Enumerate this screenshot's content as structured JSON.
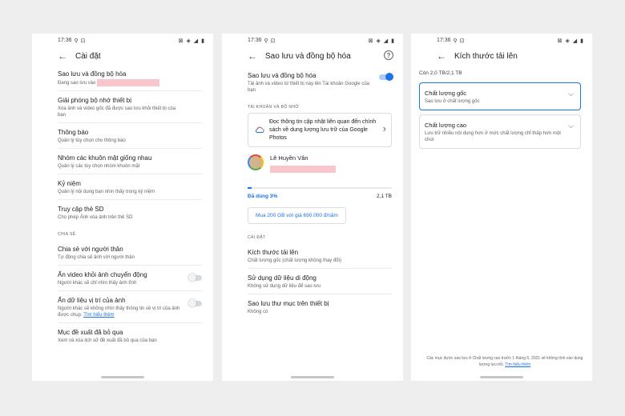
{
  "status": {
    "time": "17:36",
    "right_icons": "⊠ ◈ ◢ ▮"
  },
  "screen1": {
    "title": "Cài đặt",
    "items": [
      {
        "title": "Sao lưu và đồng bộ hóa",
        "subtitle": "Đang sao lưu vào"
      },
      {
        "title": "Giải phóng bộ nhớ thiết bị",
        "subtitle": "Xóa ảnh và video gốc đã được sao lưu khỏi thiết bị của bạn"
      },
      {
        "title": "Thông báo",
        "subtitle": "Quản lý tùy chọn cho thông báo"
      },
      {
        "title": "Nhóm các khuôn mặt giống nhau",
        "subtitle": "Quản lý các tùy chọn nhóm khuôn mặt"
      },
      {
        "title": "Kỷ niệm",
        "subtitle": "Quản lý nội dung bạn nhìn thấy trong kỷ niệm"
      },
      {
        "title": "Truy cập thẻ SD",
        "subtitle": "Cho phép Ảnh xóa ảnh trên thẻ SD"
      }
    ],
    "section_share": "CHIA SẺ",
    "share_items": [
      {
        "title": "Chia sẻ với người thân",
        "subtitle": "Tự động chia sẻ ảnh với người thân"
      },
      {
        "title": "Ẩn video khỏi ảnh chuyển động",
        "subtitle": "Người khác sẽ chỉ nhìn thấy ảnh tĩnh"
      },
      {
        "title": "Ẩn dữ liệu vị trí của ảnh",
        "subtitle": "Người khác sẽ không nhìn thấy thông tin về vị trí của ảnh được chụp.",
        "link": "Tìm hiểu thêm"
      },
      {
        "title": "Mục đề xuất đã bỏ qua",
        "subtitle": "Xem và xóa lịch sử đề xuất đã bỏ qua của bạn"
      }
    ]
  },
  "screen2": {
    "title": "Sao lưu và đồng bộ hóa",
    "backup": {
      "title": "Sao lưu và đồng bộ hóa",
      "subtitle": "Tải ảnh và video từ thiết bị này lên Tài khoản Google của bạn"
    },
    "section_account": "TÀI KHOẢN VÀ BỘ NHỚ",
    "card_text": "Đọc thông tin cập nhật liên quan đến chính sách về dung lượng lưu trữ của Google Photos",
    "account_name": "Lê Huyền Vân",
    "storage_used_label": "Đã dùng 3%",
    "storage_used_fraction": 0.03,
    "storage_total": "2,1 TB",
    "buy_label": "Mua 200 GB với giá 690.000 đ/năm",
    "section_settings": "CÀI ĐẶT",
    "settings": [
      {
        "title": "Kích thước tải lên",
        "subtitle": "Chất lượng gốc (chất lượng không thay đổi)"
      },
      {
        "title": "Sử dụng dữ liệu di động",
        "subtitle": "Không sử dụng dữ liệu để sao lưu"
      },
      {
        "title": "Sao lưu thư mục trên thiết bị",
        "subtitle": "Không có"
      }
    ]
  },
  "screen3": {
    "title": "Kích thước tải lên",
    "remaining": "Còn 2,0 TB/2,1 TB",
    "options": [
      {
        "title": "Chất lượng gốc",
        "subtitle": "Sao lưu ở chất lượng gốc"
      },
      {
        "title": "Chất lượng cao",
        "subtitle": "Lưu trữ nhiều nội dung hơn ở mức chất lượng chỉ thấp hơn một chút"
      }
    ],
    "note": "Các mục được sao lưu ở Chất lượng cao trước 1 tháng 6, 2021 sẽ không tính vào dung lượng lưu trữ.",
    "note_link": "Tìm hiểu thêm"
  },
  "colors": {
    "accent": "#1a73e8",
    "redaction": "#f9c6cc"
  }
}
